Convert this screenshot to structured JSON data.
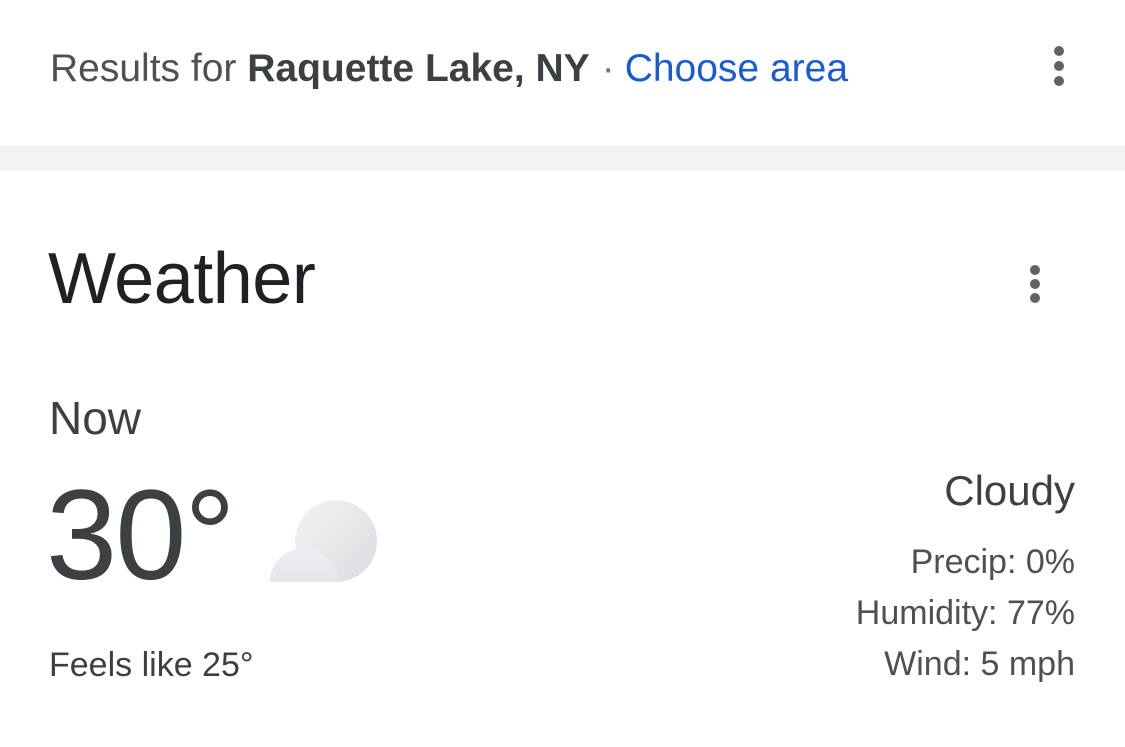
{
  "header": {
    "results_prefix": "Results for",
    "location": "Raquette Lake, NY",
    "separator": "·",
    "choose_area": "Choose area"
  },
  "weather": {
    "title": "Weather",
    "now_label": "Now",
    "temperature": "30°",
    "icon": "cloudy-icon",
    "feels_like": "Feels like 25°",
    "condition": "Cloudy",
    "precip": "Precip: 0%",
    "humidity": "Humidity: 77%",
    "wind": "Wind: 5 mph"
  },
  "colors": {
    "link": "#1a5bd3",
    "text_primary": "#202124",
    "text_secondary": "#3c4043",
    "divider": "#f1f3f4"
  }
}
